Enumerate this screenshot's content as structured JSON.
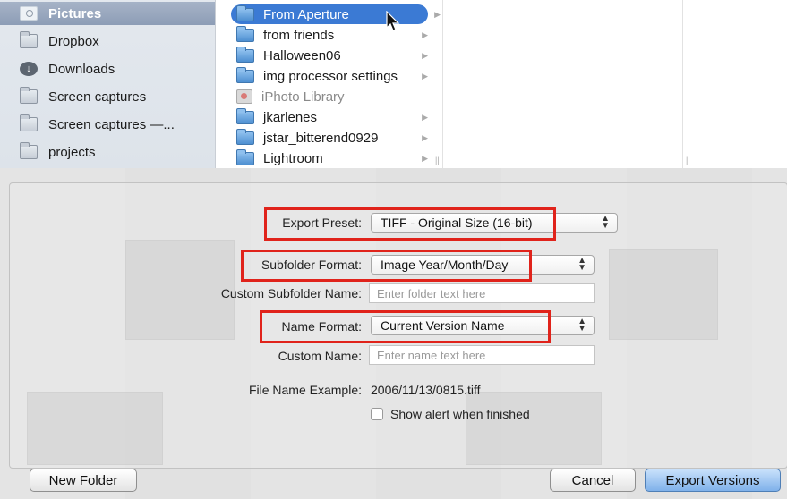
{
  "sidebar": {
    "items": [
      {
        "label": "Pictures",
        "icon": "pictures-icon",
        "selected": true
      },
      {
        "label": "Dropbox",
        "icon": "folder-icon"
      },
      {
        "label": "Downloads",
        "icon": "downloads-icon"
      },
      {
        "label": "Screen captures",
        "icon": "folder-icon"
      },
      {
        "label": "Screen captures —...",
        "icon": "folder-icon"
      },
      {
        "label": "projects",
        "icon": "folder-icon"
      }
    ]
  },
  "column": {
    "items": [
      {
        "label": "From Aperture",
        "selected": true
      },
      {
        "label": "from friends"
      },
      {
        "label": "Halloween06"
      },
      {
        "label": "img processor settings"
      },
      {
        "label": "iPhoto Library",
        "disabled": true
      },
      {
        "label": "jkarlenes"
      },
      {
        "label": "jstar_bitterend0929"
      },
      {
        "label": "Lightroom"
      }
    ]
  },
  "form": {
    "export_preset_label": "Export Preset:",
    "export_preset_value": "TIFF - Original Size (16-bit)",
    "subfolder_format_label": "Subfolder Format:",
    "subfolder_format_value": "Image Year/Month/Day",
    "custom_subfolder_label": "Custom Subfolder Name:",
    "custom_subfolder_placeholder": "Enter folder text here",
    "name_format_label": "Name Format:",
    "name_format_value": "Current Version Name",
    "custom_name_label": "Custom Name:",
    "custom_name_placeholder": "Enter name text here",
    "file_name_example_label": "File Name Example:",
    "file_name_example_value": "2006/11/13/0815.tiff",
    "show_alert_label": "Show alert when finished",
    "show_alert_checked": false
  },
  "buttons": {
    "new_folder": "New Folder",
    "cancel": "Cancel",
    "export": "Export Versions"
  },
  "colors": {
    "highlight": "#e0231b",
    "selection": "#3b7ad4",
    "default_button": "#7fb1ea"
  }
}
